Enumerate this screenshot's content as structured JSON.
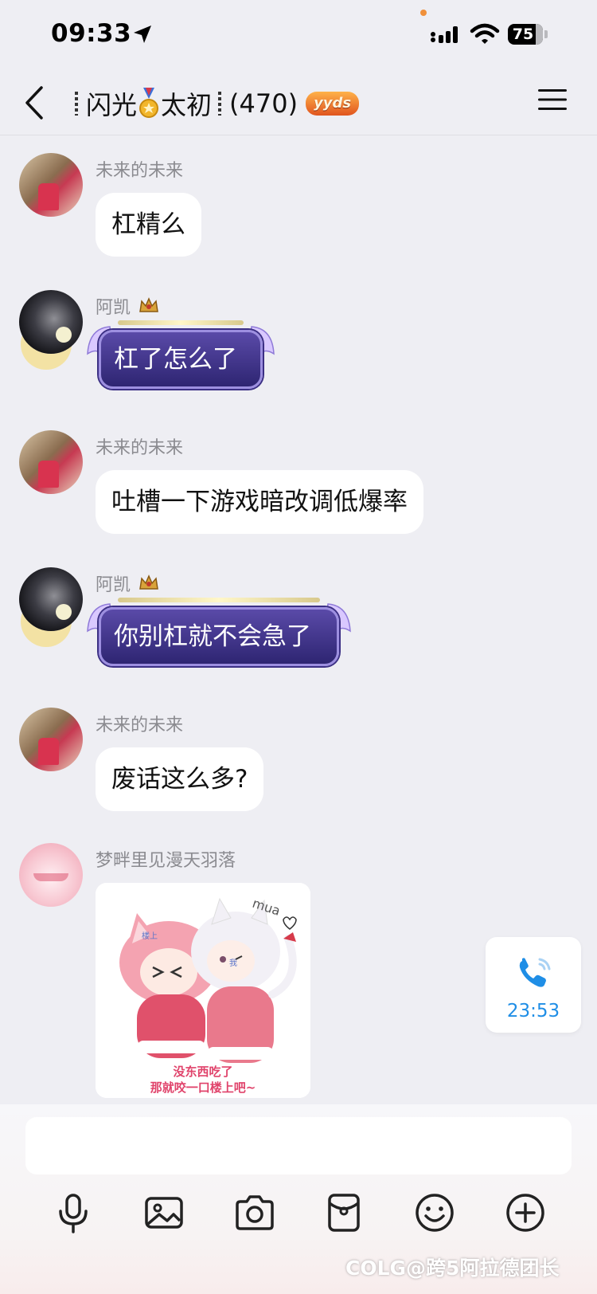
{
  "status_bar": {
    "time": "09:33",
    "battery": "75"
  },
  "header": {
    "title_part1": "闪光",
    "title_part2": "太初",
    "member_count": "(470)",
    "badge": "yyds"
  },
  "messages": [
    {
      "sender": "未来的未来",
      "text": "杠精么",
      "style": "plain"
    },
    {
      "sender": "阿凯",
      "text": "杠了怎么了",
      "style": "fancy"
    },
    {
      "sender": "未来的未来",
      "text": "吐槽一下游戏暗改调低爆率",
      "style": "plain"
    },
    {
      "sender": "阿凯",
      "text": "你别杠就不会急了",
      "style": "fancy"
    },
    {
      "sender": "未来的未来",
      "text": "废话这么多?",
      "style": "plain"
    },
    {
      "sender": "梦畔里见漫天羽落",
      "style": "sticker",
      "sticker": {
        "tag_left": "楼上",
        "tag_right": "我",
        "mua": "mua",
        "caption_line1": "没东西吃了",
        "caption_line2": "那就咬一口楼上吧~"
      }
    }
  ],
  "call": {
    "duration": "23:53"
  },
  "composer": {
    "placeholder": ""
  },
  "watermark": "COLG@跨5阿拉德团长",
  "colors": {
    "background": "#eeeef3",
    "bubble": "#ffffff",
    "fancy_bubble": "#3b2f84",
    "call_accent": "#1f8ee6",
    "sender_name": "#8b8b90"
  }
}
